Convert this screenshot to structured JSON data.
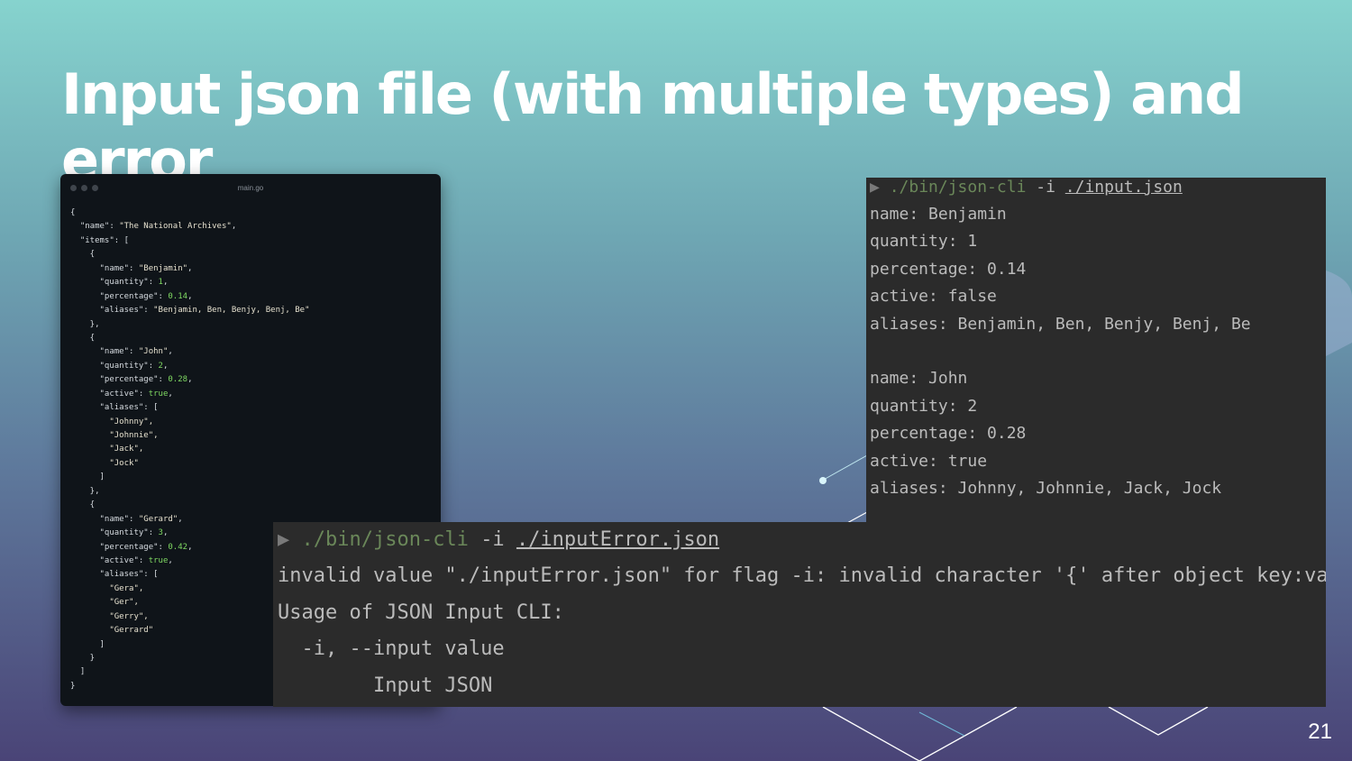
{
  "slide": {
    "title": "Input json file (with multiple types) and error",
    "page_number": "21"
  },
  "editor": {
    "filename": "main.go",
    "code_lines": [
      [
        {
          "t": "{",
          "c": "p"
        }
      ],
      [
        {
          "t": "  \"name\": ",
          "c": "p"
        },
        {
          "t": "\"The National Archives\"",
          "c": "s"
        },
        {
          "t": ",",
          "c": "p"
        }
      ],
      [
        {
          "t": "  \"items\": [",
          "c": "p"
        }
      ],
      [
        {
          "t": "    {",
          "c": "p"
        }
      ],
      [
        {
          "t": "      \"name\": ",
          "c": "p"
        },
        {
          "t": "\"Benjamin\"",
          "c": "s"
        },
        {
          "t": ",",
          "c": "p"
        }
      ],
      [
        {
          "t": "      \"quantity\": ",
          "c": "p"
        },
        {
          "t": "1",
          "c": "n"
        },
        {
          "t": ",",
          "c": "p"
        }
      ],
      [
        {
          "t": "      \"percentage\": ",
          "c": "p"
        },
        {
          "t": "0.14",
          "c": "n"
        },
        {
          "t": ",",
          "c": "p"
        }
      ],
      [
        {
          "t": "      \"aliases\": ",
          "c": "p"
        },
        {
          "t": "\"Benjamin, Ben, Benjy, Benj, Be\"",
          "c": "s"
        }
      ],
      [
        {
          "t": "    },",
          "c": "p"
        }
      ],
      [
        {
          "t": "    {",
          "c": "p"
        }
      ],
      [
        {
          "t": "      \"name\": ",
          "c": "p"
        },
        {
          "t": "\"John\"",
          "c": "s"
        },
        {
          "t": ",",
          "c": "p"
        }
      ],
      [
        {
          "t": "      \"quantity\": ",
          "c": "p"
        },
        {
          "t": "2",
          "c": "n"
        },
        {
          "t": ",",
          "c": "p"
        }
      ],
      [
        {
          "t": "      \"percentage\": ",
          "c": "p"
        },
        {
          "t": "0.28",
          "c": "n"
        },
        {
          "t": ",",
          "c": "p"
        }
      ],
      [
        {
          "t": "      \"active\": ",
          "c": "p"
        },
        {
          "t": "true",
          "c": "k"
        },
        {
          "t": ",",
          "c": "p"
        }
      ],
      [
        {
          "t": "      \"aliases\": [",
          "c": "p"
        }
      ],
      [
        {
          "t": "        \"Johnny\",",
          "c": "s"
        }
      ],
      [
        {
          "t": "        \"Johnnie\",",
          "c": "s"
        }
      ],
      [
        {
          "t": "        \"Jack\",",
          "c": "s"
        }
      ],
      [
        {
          "t": "        \"Jock\"",
          "c": "s"
        }
      ],
      [
        {
          "t": "      ]",
          "c": "p"
        }
      ],
      [
        {
          "t": "    },",
          "c": "p"
        }
      ],
      [
        {
          "t": "    {",
          "c": "p"
        }
      ],
      [
        {
          "t": "      \"name\": ",
          "c": "p"
        },
        {
          "t": "\"Gerard\"",
          "c": "s"
        },
        {
          "t": ",",
          "c": "p"
        }
      ],
      [
        {
          "t": "      \"quantity\": ",
          "c": "p"
        },
        {
          "t": "3",
          "c": "n"
        },
        {
          "t": ",",
          "c": "p"
        }
      ],
      [
        {
          "t": "      \"percentage\": ",
          "c": "p"
        },
        {
          "t": "0.42",
          "c": "n"
        },
        {
          "t": ",",
          "c": "p"
        }
      ],
      [
        {
          "t": "      \"active\": ",
          "c": "p"
        },
        {
          "t": "true",
          "c": "k"
        },
        {
          "t": ",",
          "c": "p"
        }
      ],
      [
        {
          "t": "      \"aliases\": [",
          "c": "p"
        }
      ],
      [
        {
          "t": "        \"Gera\",",
          "c": "s"
        }
      ],
      [
        {
          "t": "        \"Ger\",",
          "c": "s"
        }
      ],
      [
        {
          "t": "        \"Gerry\",",
          "c": "s"
        }
      ],
      [
        {
          "t": "        \"Gerrard\"",
          "c": "s"
        }
      ],
      [
        {
          "t": "      ]",
          "c": "p"
        }
      ],
      [
        {
          "t": "    }",
          "c": "p"
        }
      ],
      [
        {
          "t": "  ]",
          "c": "p"
        }
      ],
      [
        {
          "t": "}",
          "c": "p"
        }
      ]
    ]
  },
  "terminal_output": {
    "prompt_symbol": "▶",
    "command": "./bin/json-cli",
    "flag": "-i",
    "file": "./input.json",
    "lines": [
      "name: Benjamin",
      "quantity: 1",
      "percentage: 0.14",
      "active: false",
      "aliases: Benjamin, Ben, Benjy, Benj, Be",
      "",
      "name: John",
      "quantity: 2",
      "percentage: 0.28",
      "active: true",
      "aliases: Johnny, Johnnie, Jack, Jock"
    ]
  },
  "terminal_error": {
    "prompt_symbol": "▶",
    "command": "./bin/json-cli",
    "flag": "-i",
    "file": "./inputError.json",
    "lines": [
      "invalid value \"./inputError.json\" for flag -i: invalid character '{' after object key:value pair",
      "Usage of JSON Input CLI:",
      "  -i, --input value",
      "        Input JSON"
    ]
  },
  "colors": {
    "terminal_bg": "#2b2b2b",
    "terminal_text": "#bbbbbb",
    "command_green": "#6a8759",
    "editor_bg": "#0f1419",
    "code_number": "#7fd962"
  }
}
